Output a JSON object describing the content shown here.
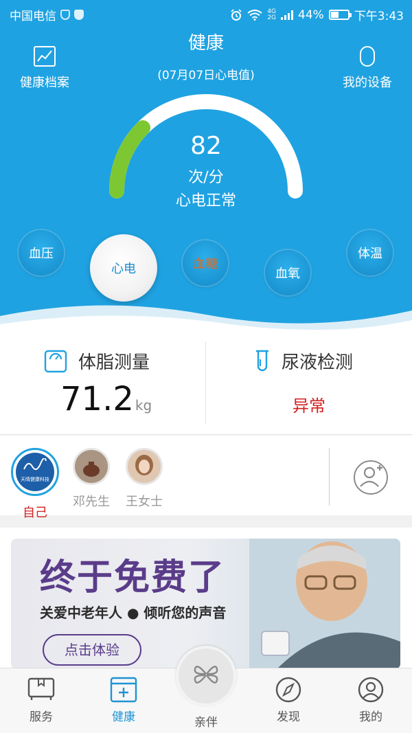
{
  "status_bar": {
    "carrier": "中国电信",
    "battery": "44%",
    "time": "下午3:43",
    "network_label_top": "4G",
    "network_label_bottom": "2G"
  },
  "header": {
    "title": "健康",
    "subtitle": "(07月07日心电值)",
    "left_button_label": "健康档案",
    "right_button_label": "我的设备"
  },
  "gauge": {
    "value": "82",
    "unit": "次/分",
    "status": "心电正常",
    "fill_fraction": 0.25,
    "track_color": "#ffffff",
    "fill_color": "#7dc832"
  },
  "metrics": [
    {
      "label": "血压",
      "active": false
    },
    {
      "label": "心电",
      "active": true
    },
    {
      "label": "血糖",
      "active": false
    },
    {
      "label": "血氧",
      "active": false
    },
    {
      "label": "体温",
      "active": false
    }
  ],
  "cards": {
    "body_fat": {
      "title": "体脂测量",
      "value": "71.2",
      "unit": "kg",
      "icon": "scale-icon"
    },
    "urine": {
      "title": "尿液检测",
      "value": "异常",
      "icon": "test-tube-icon"
    }
  },
  "family": {
    "members": [
      {
        "name": "自己",
        "selected": true,
        "avatar_text": "天晴健康科技"
      },
      {
        "name": "邓先生",
        "selected": false
      },
      {
        "name": "王女士",
        "selected": false
      }
    ],
    "add_icon": "add-user-icon"
  },
  "banner": {
    "headline": "终于免费了",
    "subline": "关爱中老年人 ● 倾听您的声音",
    "cta": "点击体验"
  },
  "tabs": [
    {
      "label": "服务",
      "icon": "clipboard-icon",
      "active": false
    },
    {
      "label": "健康",
      "icon": "plus-box-icon",
      "active": true
    },
    {
      "label": "亲伴",
      "icon": "clover-icon",
      "active": false
    },
    {
      "label": "发现",
      "icon": "compass-icon",
      "active": false
    },
    {
      "label": "我的",
      "icon": "user-icon",
      "active": false
    }
  ],
  "colors": {
    "primary_blue": "#1fa2e1",
    "active_tab": "#1f93d4",
    "alert_red": "#d21f1f",
    "banner_purple": "#5a3c8a"
  }
}
